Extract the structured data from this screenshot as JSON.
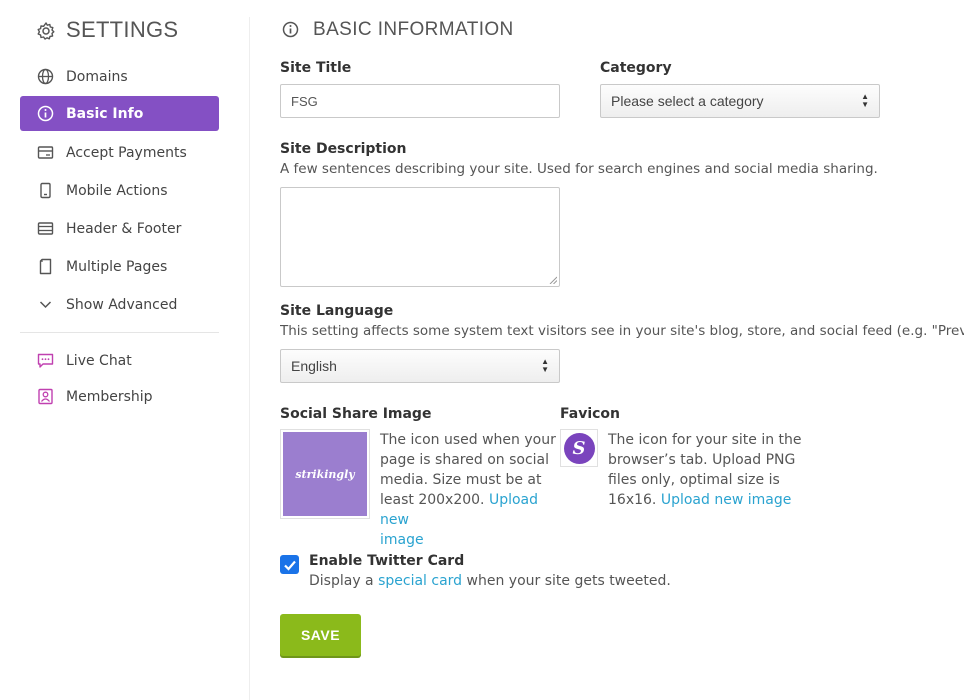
{
  "sidebar": {
    "title": "SETTINGS",
    "items": [
      {
        "label": "Domains"
      },
      {
        "label": "Basic Info"
      },
      {
        "label": "Accept Payments"
      },
      {
        "label": "Mobile Actions"
      },
      {
        "label": "Header & Footer"
      },
      {
        "label": "Multiple Pages"
      },
      {
        "label": "Show Advanced"
      }
    ],
    "extra_items": [
      {
        "label": "Live Chat"
      },
      {
        "label": "Membership"
      }
    ],
    "active_item": "Basic Info",
    "active_color": "#8450c4",
    "extra_icon_color": "#c040b0"
  },
  "main": {
    "title": "BASIC INFORMATION",
    "site_title": {
      "label": "Site Title",
      "value": "FSG"
    },
    "category": {
      "label": "Category",
      "selected": "Please select a category"
    },
    "site_description": {
      "label": "Site Description",
      "help": "A few sentences describing your site. Used for search engines and social media sharing.",
      "value": ""
    },
    "site_language": {
      "label": "Site Language",
      "help": "This setting affects some system text visitors see in your site's blog, store, and social feed (e.g. \"Previous\" a",
      "selected": "English"
    },
    "social_share_image": {
      "label": "Social Share Image",
      "thumb_text": "strikingly",
      "desc_lines": [
        "The icon used when your",
        "page is shared on social",
        "media. Size must be at",
        "least 200x200."
      ],
      "link_part1": "Upload new",
      "link_part2": "image"
    },
    "favicon": {
      "label": "Favicon",
      "letter": "S",
      "desc_lines": [
        "The icon for your site in the",
        "browser’s tab. Upload PNG",
        "files only, optimal size is",
        "16x16."
      ],
      "link": "Upload new image"
    },
    "twitter_card": {
      "label": "Enable Twitter Card",
      "checked": true,
      "desc_before": "Display a",
      "desc_link": "special card",
      "desc_after": "when your site gets tweeted."
    },
    "save_label": "SAVE"
  },
  "colors": {
    "accent": "#8450c4",
    "link": "#2aa3d0",
    "save": "#8bba1b",
    "checkbox": "#1a73e8"
  }
}
